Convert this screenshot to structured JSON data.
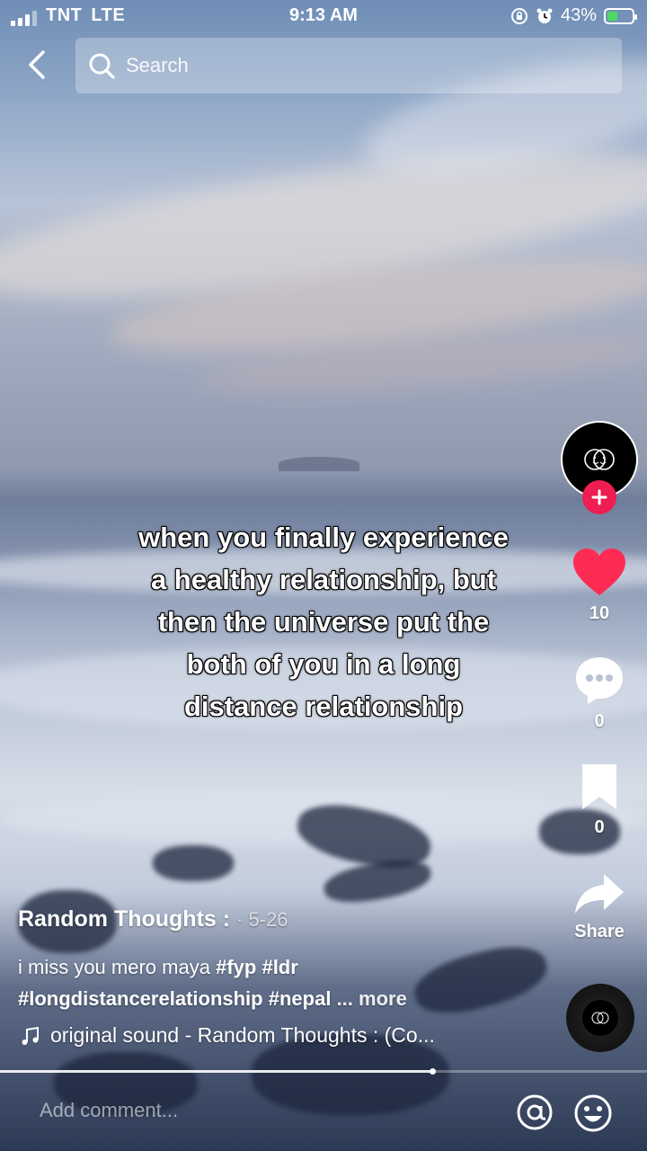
{
  "status_bar": {
    "carrier": "TNT",
    "network": "LTE",
    "time": "9:13 AM",
    "battery": "43%",
    "battery_fraction": 0.43,
    "icons": [
      "signal-icon",
      "lock-rotation-icon",
      "alarm-icon",
      "battery-charging-icon"
    ]
  },
  "header": {
    "back_icon": "back-chevron-icon",
    "search_placeholder": "Search"
  },
  "video": {
    "caption_lines": [
      "when you finally experience",
      "a healthy relationship, but",
      "then the universe put the",
      "both of you in a long",
      "distance relationship"
    ],
    "progress_fraction": 0.67
  },
  "rail": {
    "follow_icon": "plus-icon",
    "likes": "10",
    "comments": "0",
    "saves": "0",
    "share_label": "Share"
  },
  "post": {
    "username": "Random Thoughts :",
    "date": "· 5-26",
    "description_text": "i miss you mero maya",
    "hashtags_line1": [
      "#fyp",
      "#ldr"
    ],
    "hashtags_line2": [
      "#longdistancerelationship",
      "#nepal"
    ],
    "more_label": "... more",
    "sound": "original sound - Random Thoughts : (Co..."
  },
  "comment_bar": {
    "placeholder": "Add comment...",
    "mention_icon": "at-icon",
    "emoji_icon": "emoji-icon"
  },
  "colors": {
    "like": "#fe2c55",
    "follow": "#ee1d52",
    "battery": "#4cd964"
  }
}
